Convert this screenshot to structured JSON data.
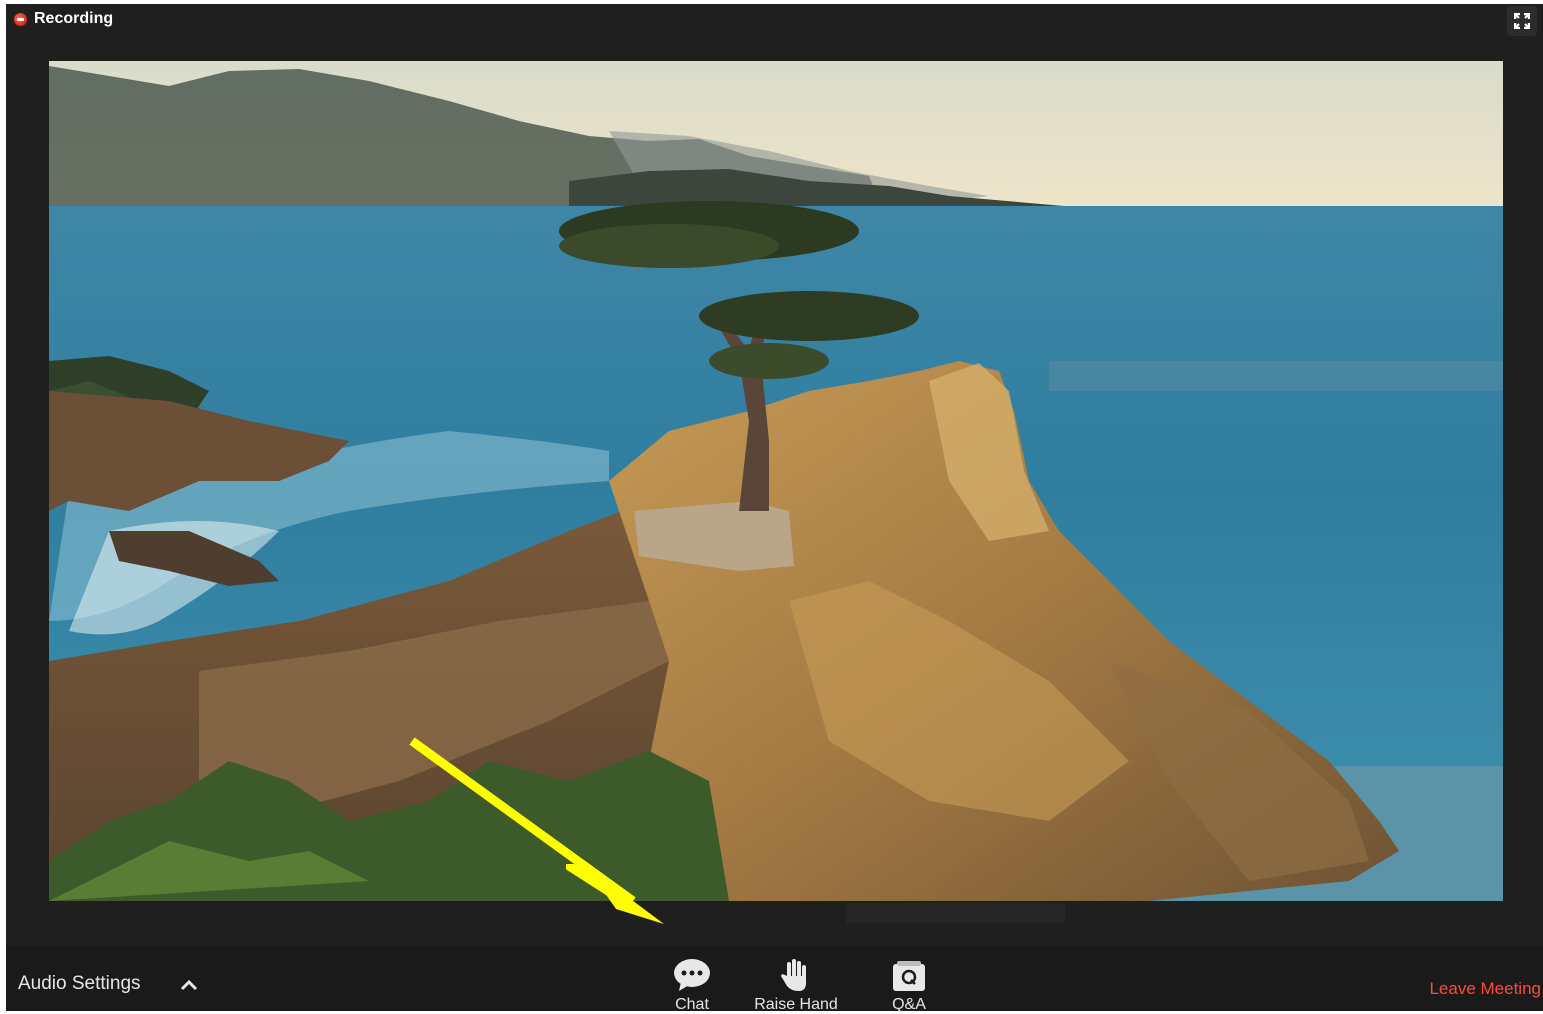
{
  "recording": {
    "label": "Recording"
  },
  "toolbar": {
    "audio_settings": "Audio Settings",
    "chat": "Chat",
    "raise_hand": "Raise Hand",
    "qa": "Q&A",
    "leave": "Leave Meeting"
  },
  "icons": {
    "recording": "record-dot-icon",
    "fullscreen": "fullscreen-icon",
    "caret": "chevron-up-icon",
    "chat": "chat-bubble-icon",
    "raise_hand": "hand-icon",
    "qa": "qa-icon",
    "annotation": "yellow-arrow"
  },
  "colors": {
    "window_bg": "#1f1f1f",
    "toolbar_bg": "#1a1a1a",
    "leave": "#ff4a3d",
    "recording_dot": "#e0322a",
    "arrow": "#ffff00"
  }
}
